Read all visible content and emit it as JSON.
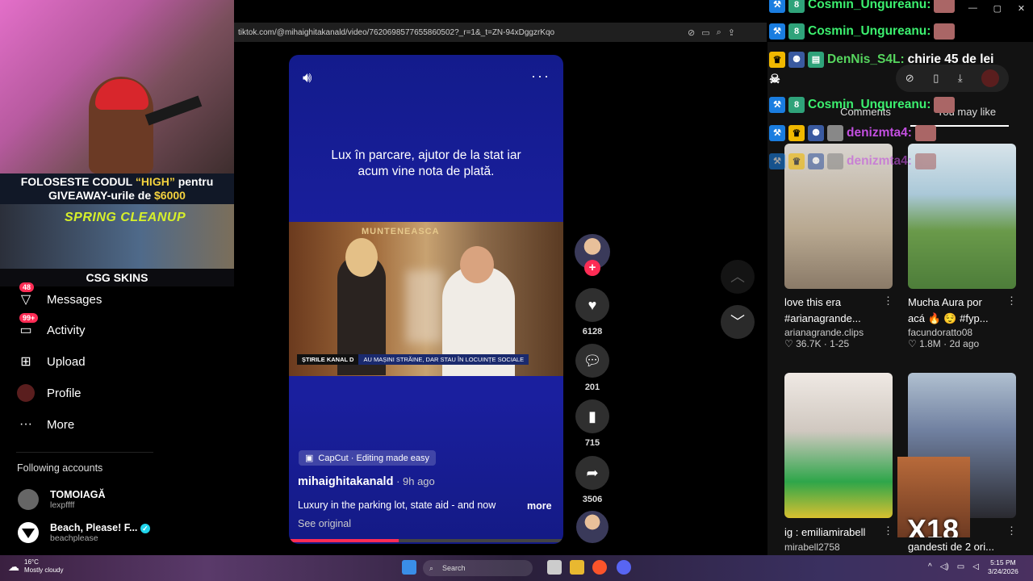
{
  "browser": {
    "url": "tiktok.com/@mihaighitakanald/video/7620698577655860502?_r=1&_t=ZN-94xDggzrKqo"
  },
  "overlay": {
    "promo_line1_a": "FOLOSESTE CODUL ",
    "promo_code": "“HIGH”",
    "promo_line1_b": " pentru",
    "promo_line2_a": "GIVEAWAY-urile de ",
    "promo_amount": "$6000",
    "banner_title": "SPRING CLEANUP",
    "brand": "CSG SKINS"
  },
  "sidebar": {
    "items": [
      {
        "label": "Messages",
        "badge": "48",
        "icon": "paper-plane-icon"
      },
      {
        "label": "Activity",
        "badge": "99+",
        "icon": "inbox-icon"
      },
      {
        "label": "Upload",
        "icon": "plus-square-icon"
      },
      {
        "label": "Profile",
        "icon": "avatar-icon"
      },
      {
        "label": "More",
        "icon": "dots-icon"
      }
    ],
    "following_heading": "Following accounts",
    "accounts": [
      {
        "name": "TOMOIAGĂ",
        "handle": "lexpffff"
      },
      {
        "name": "Beach, Please! F...",
        "handle": "beachplease"
      }
    ]
  },
  "video": {
    "headline": "Lux în parcare, ajutor de la stat iar acum vine nota de plată.",
    "photo_sign": "MUNTENEASCA",
    "ticker_channel": "ȘTIRILE KANAL D",
    "ticker_text": "AU MAȘINI STRĂINE, DAR STAU ÎN LOCUINȚE SOCIALE",
    "capcut": "CapCut · Editing made easy",
    "author": "mihaighitakanald",
    "posted": " · 9h ago",
    "description": "Luxury in the parking lot, state aid - and now",
    "more": "more",
    "see_original": "See original",
    "progress": 0.4
  },
  "actions": {
    "likes": "6128",
    "comments": "201",
    "saves": "715",
    "shares": "3506"
  },
  "right_panel": {
    "tabs": [
      "Comments",
      "You may like"
    ],
    "videos": [
      {
        "caption1": "love this era",
        "caption2": "#arianagrande...",
        "author": "arianagrande.clips",
        "likes": "36.7K",
        "date": "1-25"
      },
      {
        "caption1": "Mucha Aura por",
        "caption2": "acá 🔥 😌 #fyp...",
        "author": "facundoratto08",
        "likes": "1.8M",
        "date": "2d ago"
      },
      {
        "caption1": "ig : emiliamirabell",
        "caption2": "",
        "author": "mirabell2758",
        "likes": "",
        "date": ""
      },
      {
        "caption1": "",
        "caption2": "",
        "author": "gandesti de 2 ori...",
        "likes": "",
        "date": ""
      }
    ]
  },
  "chat": [
    {
      "user": "Cosmin_Ungureanu:",
      "msg": ""
    },
    {
      "user": "Cosmin_Ungureanu:",
      "msg": ""
    },
    {
      "user": "DenNis_S4L:",
      "msg": "chirie 45 de lei"
    },
    {
      "user": "Cosmin_Ungureanu:",
      "msg": ""
    },
    {
      "user": "denizmta4:",
      "msg": ""
    },
    {
      "user": "denizmta4:",
      "msg": ""
    }
  ],
  "x18_text": "X18",
  "taskbar": {
    "temp": "16°C",
    "weather": "Mostly cloudy",
    "search": "Search",
    "time": "5:15 PM",
    "date": "3/24/2026"
  },
  "colors": {
    "accent": "#fe2c55",
    "video_bg": "#1a1f9e",
    "chat_user": "#3cf06f"
  }
}
